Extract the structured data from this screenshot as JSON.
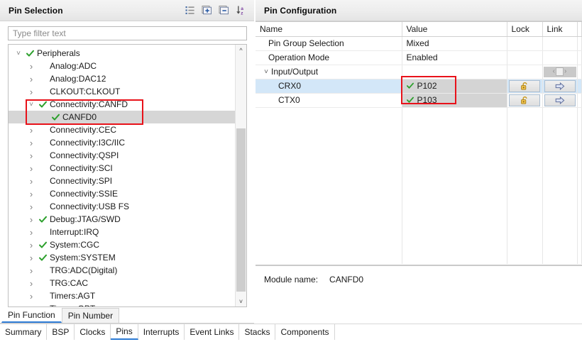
{
  "left_panel": {
    "title": "Pin Selection",
    "toolbar": [
      {
        "name": "show-categories-icon",
        "tooltip": "Show Categories"
      },
      {
        "name": "expand-all-icon",
        "tooltip": "Expand All"
      },
      {
        "name": "collapse-all-icon",
        "tooltip": "Collapse All"
      },
      {
        "name": "sort-alphabetical-icon",
        "tooltip": "Sort Alphabetically"
      }
    ],
    "filter": {
      "placeholder": "Type filter text",
      "value": ""
    },
    "tree": [
      {
        "label": "Peripherals",
        "indent": 0,
        "twist": "expanded",
        "check": true,
        "selected": false
      },
      {
        "label": "Analog:ADC",
        "indent": 1,
        "twist": "collapsed",
        "check": false,
        "selected": false
      },
      {
        "label": "Analog:DAC12",
        "indent": 1,
        "twist": "collapsed",
        "check": false,
        "selected": false
      },
      {
        "label": "CLKOUT:CLKOUT",
        "indent": 1,
        "twist": "collapsed",
        "check": false,
        "selected": false
      },
      {
        "label": "Connectivity:CANFD",
        "indent": 1,
        "twist": "expanded",
        "check": true,
        "selected": false
      },
      {
        "label": "CANFD0",
        "indent": 2,
        "twist": "none",
        "check": true,
        "selected": true
      },
      {
        "label": "Connectivity:CEC",
        "indent": 1,
        "twist": "collapsed",
        "check": false,
        "selected": false
      },
      {
        "label": "Connectivity:I3C/IIC",
        "indent": 1,
        "twist": "collapsed",
        "check": false,
        "selected": false
      },
      {
        "label": "Connectivity:QSPI",
        "indent": 1,
        "twist": "collapsed",
        "check": false,
        "selected": false
      },
      {
        "label": "Connectivity:SCI",
        "indent": 1,
        "twist": "collapsed",
        "check": false,
        "selected": false
      },
      {
        "label": "Connectivity:SPI",
        "indent": 1,
        "twist": "collapsed",
        "check": false,
        "selected": false
      },
      {
        "label": "Connectivity:SSIE",
        "indent": 1,
        "twist": "collapsed",
        "check": false,
        "selected": false
      },
      {
        "label": "Connectivity:USB FS",
        "indent": 1,
        "twist": "collapsed",
        "check": false,
        "selected": false
      },
      {
        "label": "Debug:JTAG/SWD",
        "indent": 1,
        "twist": "collapsed",
        "check": true,
        "selected": false
      },
      {
        "label": "Interrupt:IRQ",
        "indent": 1,
        "twist": "collapsed",
        "check": false,
        "selected": false
      },
      {
        "label": "System:CGC",
        "indent": 1,
        "twist": "collapsed",
        "check": true,
        "selected": false
      },
      {
        "label": "System:SYSTEM",
        "indent": 1,
        "twist": "collapsed",
        "check": true,
        "selected": false
      },
      {
        "label": "TRG:ADC(Digital)",
        "indent": 1,
        "twist": "collapsed",
        "check": false,
        "selected": false
      },
      {
        "label": "TRG:CAC",
        "indent": 1,
        "twist": "collapsed",
        "check": false,
        "selected": false
      },
      {
        "label": "Timers:AGT",
        "indent": 1,
        "twist": "collapsed",
        "check": false,
        "selected": false
      },
      {
        "label": "Timers:GPT",
        "indent": 1,
        "twist": "collapsed",
        "check": false,
        "selected": false
      }
    ],
    "subtabs": [
      {
        "label": "Pin Function",
        "active": true
      },
      {
        "label": "Pin Number",
        "active": false
      }
    ]
  },
  "right_panel": {
    "title": "Pin Configuration",
    "columns": [
      "Name",
      "Value",
      "Lock",
      "Link"
    ],
    "rows": [
      {
        "name": "Pin Group Selection",
        "indent": 1,
        "twist": "none",
        "value": "Mixed",
        "value_check": false,
        "value_combo": false,
        "lock": false,
        "link": false,
        "spinner": false,
        "selected": false
      },
      {
        "name": "Operation Mode",
        "indent": 1,
        "twist": "none",
        "value": "Enabled",
        "value_check": false,
        "value_combo": false,
        "lock": false,
        "link": false,
        "spinner": false,
        "selected": false
      },
      {
        "name": "Input/Output",
        "indent": 0,
        "twist": "expanded",
        "value": "",
        "value_check": false,
        "value_combo": false,
        "lock": false,
        "link": false,
        "spinner": true,
        "selected": false
      },
      {
        "name": "CRX0",
        "indent": 2,
        "twist": "none",
        "value": "P102",
        "value_check": true,
        "value_combo": true,
        "lock": true,
        "link": true,
        "spinner": false,
        "selected": true
      },
      {
        "name": "CTX0",
        "indent": 2,
        "twist": "none",
        "value": "P103",
        "value_check": true,
        "value_combo": true,
        "lock": true,
        "link": true,
        "spinner": false,
        "selected": false
      }
    ],
    "module": {
      "label": "Module name:",
      "value": "CANFD0"
    }
  },
  "bottom_tabs": [
    {
      "label": "Summary",
      "active": false
    },
    {
      "label": "BSP",
      "active": false
    },
    {
      "label": "Clocks",
      "active": false
    },
    {
      "label": "Pins",
      "active": true
    },
    {
      "label": "Interrupts",
      "active": false
    },
    {
      "label": "Event Links",
      "active": false
    },
    {
      "label": "Stacks",
      "active": false
    },
    {
      "label": "Components",
      "active": false
    }
  ],
  "colors": {
    "accent": "#2d7bd4",
    "annotation": "#e8121a",
    "check_green": "#2ca02c",
    "selection_tree": "#d6d6d6",
    "selection_table": "#d3e7f8",
    "lock_gold": "#d7a22a"
  }
}
